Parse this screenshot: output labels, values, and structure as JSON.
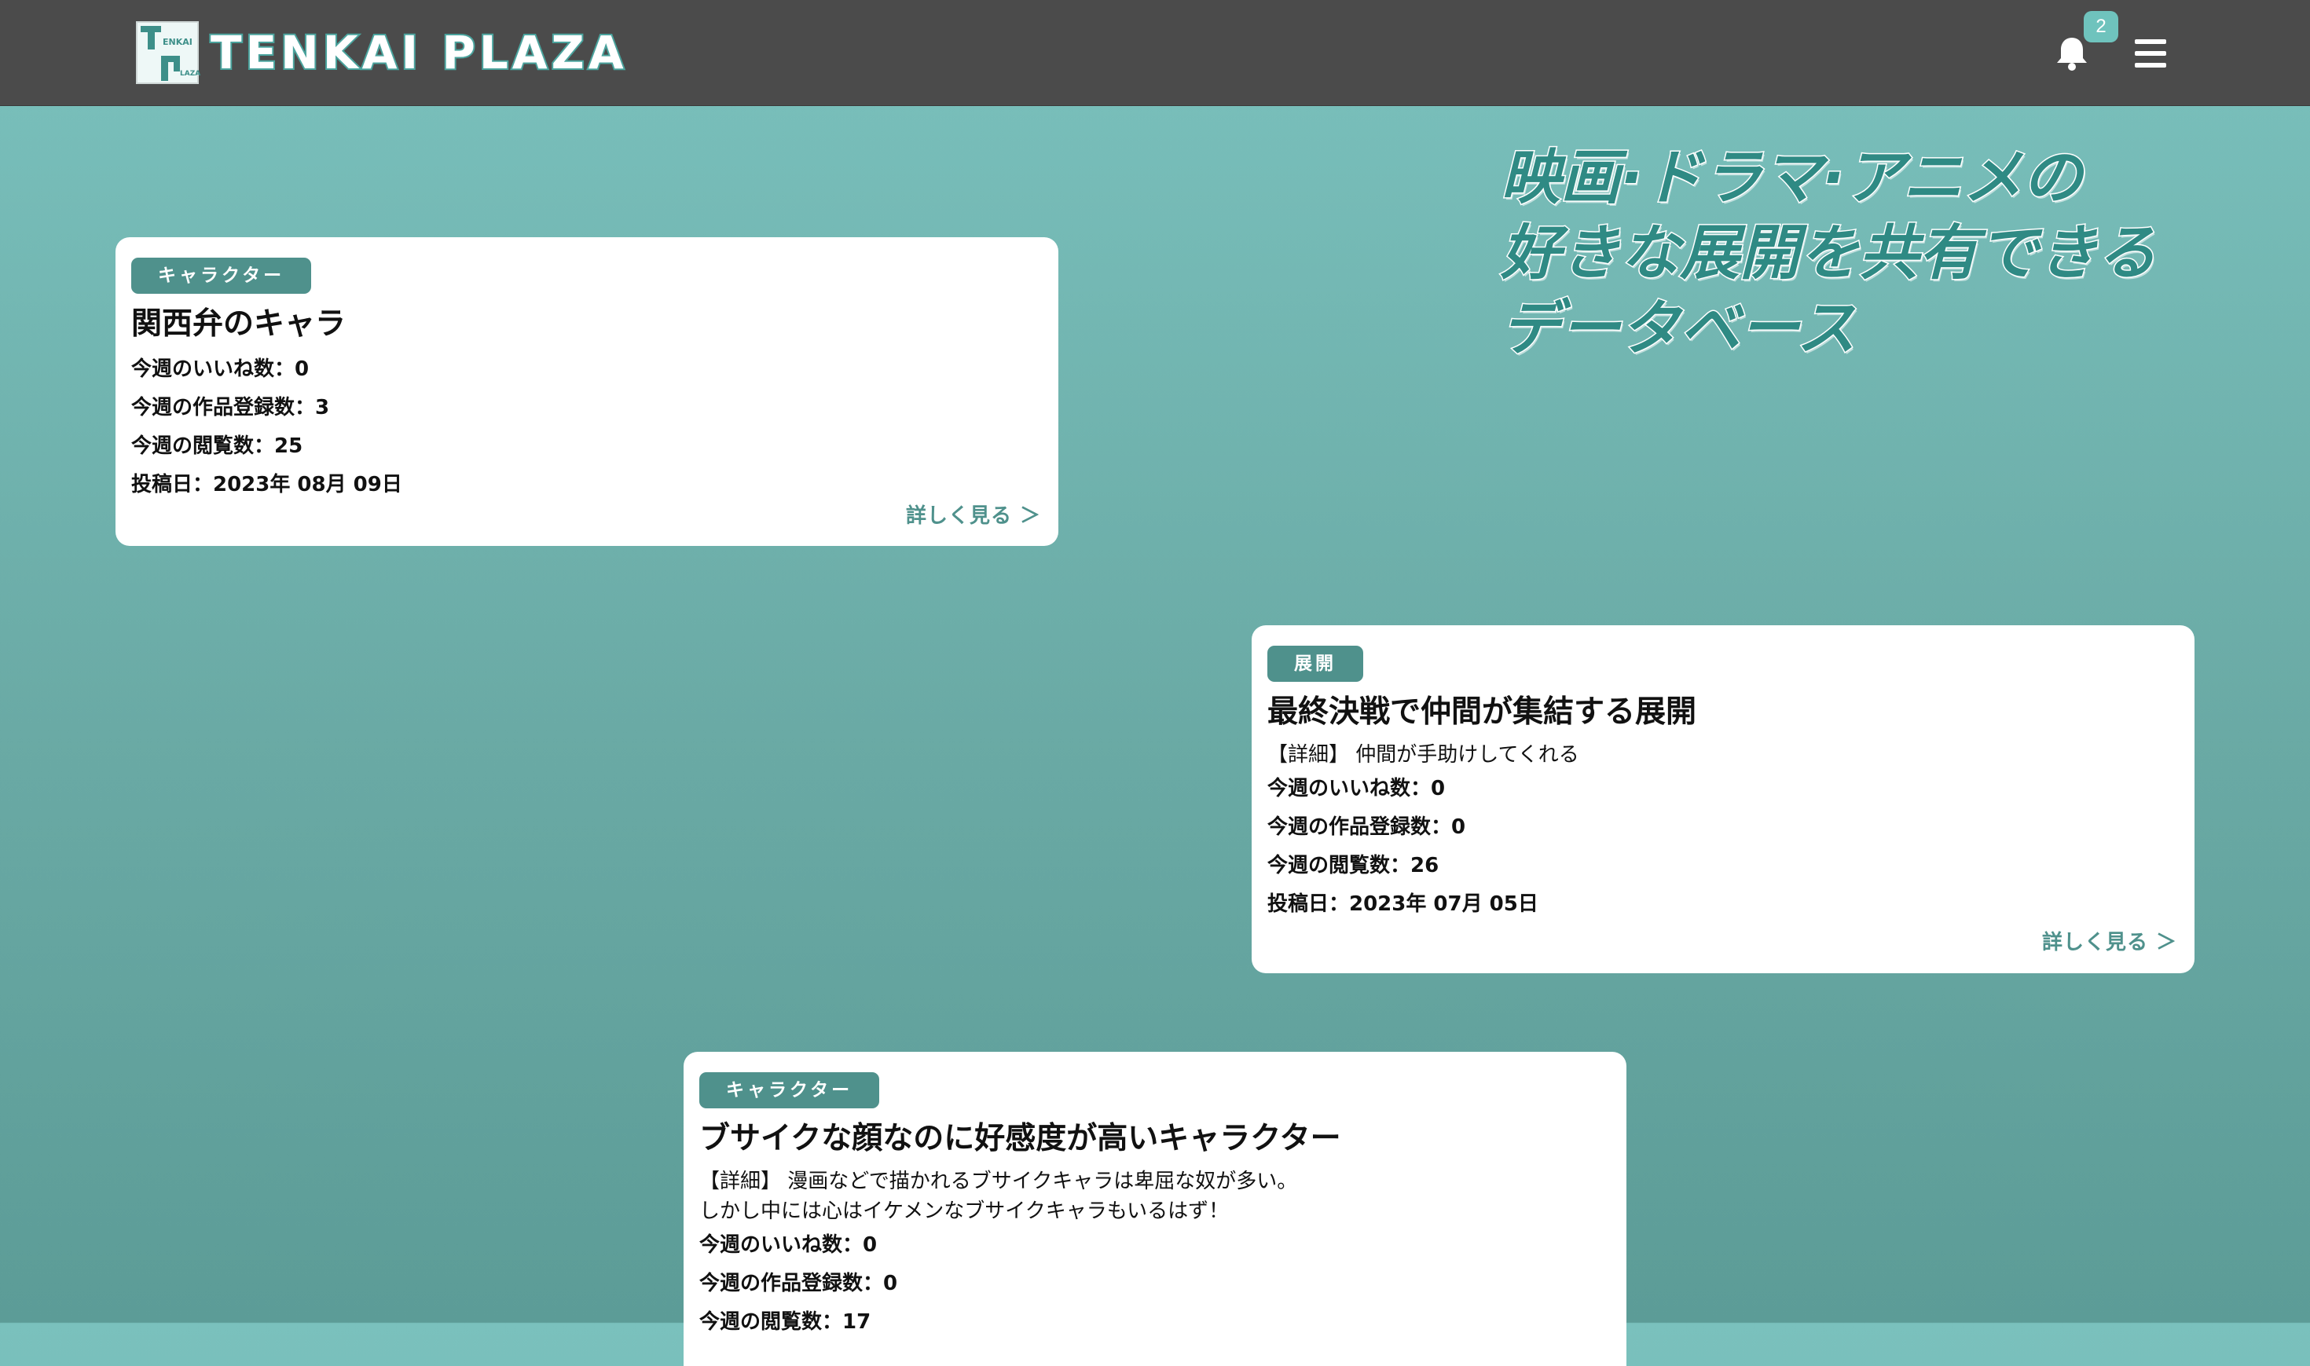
{
  "header": {
    "brand": "TENKAI PLAZA",
    "logo_text_top": "ENKAI",
    "logo_text_bottom": "LAZA",
    "notification_count": "2",
    "icons": [
      "bell-icon",
      "menu-icon"
    ]
  },
  "hero": {
    "lines": [
      "映画·ドラマ·アニメの",
      "好きな展開を共有できる",
      "データベース"
    ]
  },
  "cards": [
    {
      "tag": "キャラクター",
      "title": "関西弁のキャラ",
      "likes": "今週のいいね数：0",
      "works": "今週の作品登録数：3",
      "views": "今週の閲覧数：25",
      "posted": "投稿日：2023年 08月 09日",
      "more": "詳しく見る ＞"
    },
    {
      "tag": "展開",
      "title": "最終決戦で仲間が集結する展開",
      "detail_line1": "【詳細】 仲間が手助けしてくれる",
      "likes": "今週のいいね数：0",
      "works": "今週の作品登録数：0",
      "views": "今週の閲覧数：26",
      "posted": "投稿日：2023年 07月 05日",
      "more": "詳しく見る ＞"
    },
    {
      "tag": "キャラクター",
      "title": "ブサイクな顔なのに好感度が高いキャラクター",
      "detail_line1": "【詳細】 漫画などで描かれるブサイクキャラは卑屈な奴が多い。",
      "detail_line2": "しかし中には心はイケメンなブサイクキャラもいるはず！",
      "likes": "今週のいいね数：0",
      "works": "今週の作品登録数：0",
      "views": "今週の閲覧数：17"
    }
  ],
  "colors": {
    "header_bg": "#4b4b4b",
    "accent": "#4f918c",
    "badge": "#6fc3bd",
    "background_top": "#7ac1bd",
    "background_bottom": "#5c9c97"
  }
}
